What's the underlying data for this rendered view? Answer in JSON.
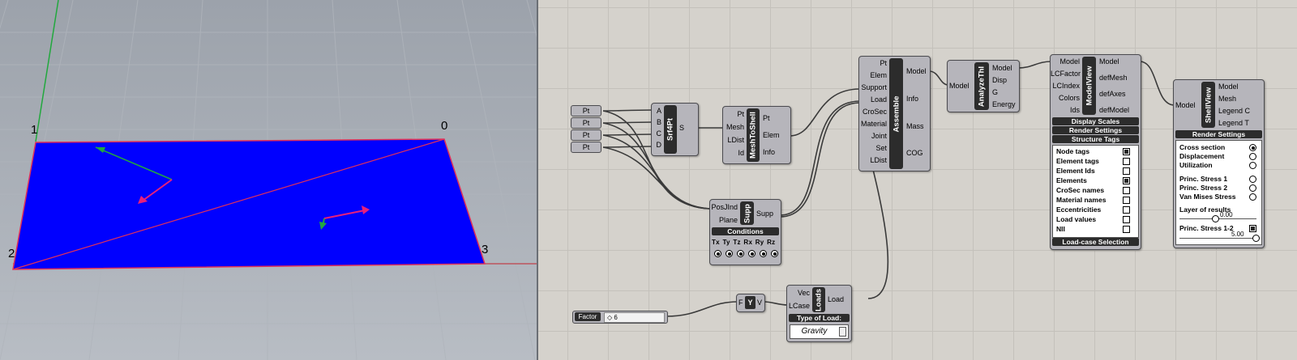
{
  "viewport": {
    "corner_labels": [
      "0",
      "1",
      "2",
      "3"
    ],
    "colors": {
      "surface": "#0000ff",
      "edge": "#e0305a",
      "axis_green": "#1b9a3c",
      "arrow": "#e8207a"
    }
  },
  "points": [
    "Pt",
    "Pt",
    "Pt",
    "Pt"
  ],
  "srf4pt": {
    "name": "Srf4Pt",
    "inputs": [
      "A",
      "B",
      "C",
      "D"
    ],
    "output": "S"
  },
  "mesh_to_shell": {
    "name": "MeshToShell",
    "inputs": [
      "Pt",
      "Mesh",
      "LDist",
      "Id"
    ],
    "outputs": [
      "Pt",
      "Elem",
      "Info"
    ]
  },
  "assemble": {
    "name": "Assemble",
    "inputs": [
      "Pt",
      "Elem",
      "Support",
      "Load",
      "CroSec",
      "Material",
      "Joint",
      "Set",
      "LDist"
    ],
    "outputs": [
      "Model",
      "Info",
      "Mass",
      "COG"
    ]
  },
  "analyze": {
    "name": "AnalyzeThI",
    "input": "Model",
    "outputs": [
      "Model",
      "Disp",
      "G",
      "Energy"
    ]
  },
  "modelview": {
    "name": "ModelView",
    "inputs": [
      "Model",
      "LCFactor",
      "LCIndex",
      "Colors",
      "Ids"
    ],
    "outputs": [
      "Model",
      "defMesh",
      "defAxes",
      "defModel"
    ],
    "bars": [
      "Display Scales",
      "Render Settings",
      "Structure Tags"
    ],
    "tags": [
      {
        "label": "Node tags",
        "checked": true
      },
      {
        "label": "Element tags",
        "checked": false
      },
      {
        "label": "Element Ids",
        "checked": false
      },
      {
        "label": "Elements",
        "checked": true
      },
      {
        "label": "CroSec names",
        "checked": false
      },
      {
        "label": "Material names",
        "checked": false
      },
      {
        "label": "Eccentricities",
        "checked": false
      },
      {
        "label": "Load values",
        "checked": false
      },
      {
        "label": "NII",
        "checked": false
      }
    ],
    "footer": "Load-case Selection"
  },
  "shellview": {
    "name": "ShellView",
    "input": "Model",
    "outputs": [
      "Model",
      "Mesh",
      "Legend C",
      "Legend T"
    ],
    "bar": "Render Settings",
    "options": [
      {
        "label": "Cross section",
        "selected": true
      },
      {
        "label": "Displacement",
        "selected": false
      },
      {
        "label": "Utilization",
        "selected": false
      },
      {
        "label": "Princ. Stress 1",
        "selected": false
      },
      {
        "label": "Princ. Stress 2",
        "selected": false
      },
      {
        "label": "Van Mises Stress",
        "selected": false
      }
    ],
    "layer_label": "Layer of results",
    "layer_value": "0.00",
    "princ_label": "Princ. Stress 1-2",
    "princ_checked": true,
    "princ_value": "5.00"
  },
  "supp": {
    "name": "Supp",
    "inputs": [
      "PosJInd",
      "Plane"
    ],
    "output": "Supp",
    "bar": "Conditions",
    "dofs": [
      "Tx",
      "Ty",
      "Tz",
      "Rx",
      "Ry",
      "Rz"
    ]
  },
  "slider": {
    "label": "Factor",
    "value": "6"
  },
  "vec_y": {
    "name": "Y",
    "input": "F",
    "output": "V"
  },
  "loads": {
    "name": "Loads",
    "inputs": [
      "Vec",
      "LCase"
    ],
    "output": "Load",
    "bar": "Type of Load:",
    "value": "Gravity"
  }
}
